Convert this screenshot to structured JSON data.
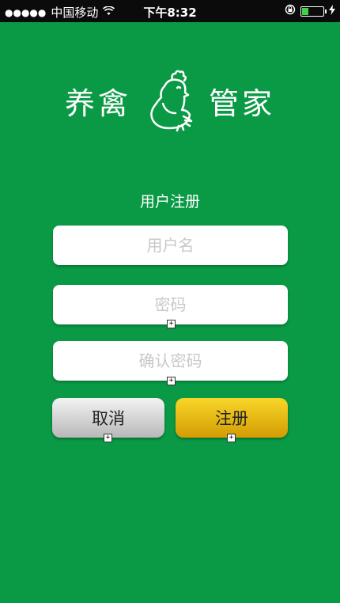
{
  "status_bar": {
    "signal": "●●●●●",
    "carrier": "中国移动",
    "time": "下午8:32"
  },
  "logo": {
    "left_text": "养禽",
    "right_text": "管家"
  },
  "form": {
    "title": "用户注册",
    "username_placeholder": "用户名",
    "password_placeholder": "密码",
    "confirm_placeholder": "确认密码"
  },
  "buttons": {
    "cancel": "取消",
    "register": "注册"
  },
  "colors": {
    "background": "#0a9a45",
    "register_button": "#e8bb12",
    "cancel_button": "#d5d5d5"
  }
}
